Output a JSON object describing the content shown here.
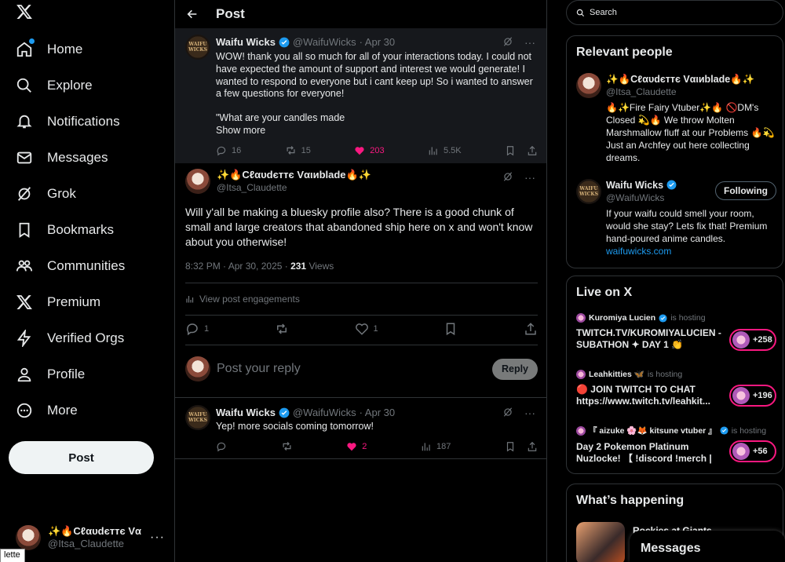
{
  "nav": {
    "items": [
      {
        "label": "Home",
        "icon": "home-icon"
      },
      {
        "label": "Explore",
        "icon": "search-icon"
      },
      {
        "label": "Notifications",
        "icon": "bell-icon"
      },
      {
        "label": "Messages",
        "icon": "mail-icon"
      },
      {
        "label": "Grok",
        "icon": "grok-icon"
      },
      {
        "label": "Bookmarks",
        "icon": "bookmark-icon"
      },
      {
        "label": "Communities",
        "icon": "communities-icon"
      },
      {
        "label": "Premium",
        "icon": "x-logo-icon"
      },
      {
        "label": "Verified Orgs",
        "icon": "lightning-icon"
      },
      {
        "label": "Profile",
        "icon": "person-icon"
      },
      {
        "label": "More",
        "icon": "more-circle-icon"
      }
    ],
    "post_label": "Post"
  },
  "account": {
    "name": "✨🔥Cℓαυdєттє Vα…",
    "handle": "@Itsa_Claudette"
  },
  "tooltip": "lette",
  "main": {
    "title": "Post",
    "parent": {
      "name": "Waifu Wicks",
      "handle": "@WaifuWicks",
      "date": "· Apr 30",
      "text": "WOW! thank you all so much for all of your interactions today. I could not have expected the amount of support and interest we would generate! I wanted to respond to everyone but i cant keep up! So i wanted to answer a few questions for everyone!",
      "text2": "\"What are your candles made",
      "show_more": "Show more",
      "replies": "16",
      "reposts": "15",
      "likes": "203",
      "views": "5.5K"
    },
    "focus": {
      "name": "✨🔥Cℓαυdєттє Vαιиblade🔥✨",
      "handle": "@Itsa_Claudette",
      "text": "Will y'all be making a bluesky profile also? There is a good chunk of small and large creators that abandoned ship here on x and won't know about you otherwise!",
      "time": "8:32 PM · Apr 30, 2025 · ",
      "views_count": "231",
      "views_label": " Views",
      "engagements": "View post engagements",
      "replies": "1",
      "likes": "1"
    },
    "reply_placeholder": "Post your reply",
    "reply_button": "Reply",
    "child": {
      "name": "Waifu Wicks",
      "handle": "@WaifuWicks",
      "date": "· Apr 30",
      "text": "Yep! more socials coming tomorrow!",
      "likes": "2",
      "views": "187"
    }
  },
  "right": {
    "search_placeholder": "Search",
    "relevant": {
      "title": "Relevant people",
      "people": [
        {
          "name": "✨🔥Cℓαυdєттє Vαιиblade🔥✨",
          "handle": "@Itsa_Claudette",
          "bio": "🔥✨Fire Fairy Vtuber✨🔥 🚫DM's Closed 💫🔥 We throw Molten Marshmallow fluff at our Problems 🔥💫 Just an Archfey out here collecting dreams."
        },
        {
          "name": "Waifu Wicks",
          "handle": "@WaifuWicks",
          "bio": "If your waifu could smell your room, would she stay? Lets fix that! Premium hand-poured anime candles.",
          "link": "waifuwicks.com",
          "button": "Following"
        }
      ]
    },
    "live": {
      "title": "Live on X",
      "hosting": "is hosting",
      "items": [
        {
          "host": "Kuromiya Lucien",
          "title": "TWITCH.TV/KUROMIYALUCIEN - SUBATHON ✦ DAY 1 👏",
          "count": "+258"
        },
        {
          "host": "Leahkitties 🦋",
          "title": "🔴 JOIN TWITCH TO CHAT https://www.twitch.tv/leahkit...",
          "count": "+196"
        },
        {
          "host": "『 aizuke 🌸🦊 kitsune vtuber 』",
          "title": "Day 2 Pokemon Platinum Nuzlocke! 【 !discord !merch | ...",
          "count": "+56"
        }
      ]
    },
    "happening": {
      "title": "What’s happening",
      "first": "Rockies at Giants"
    },
    "messages": "Messages"
  }
}
